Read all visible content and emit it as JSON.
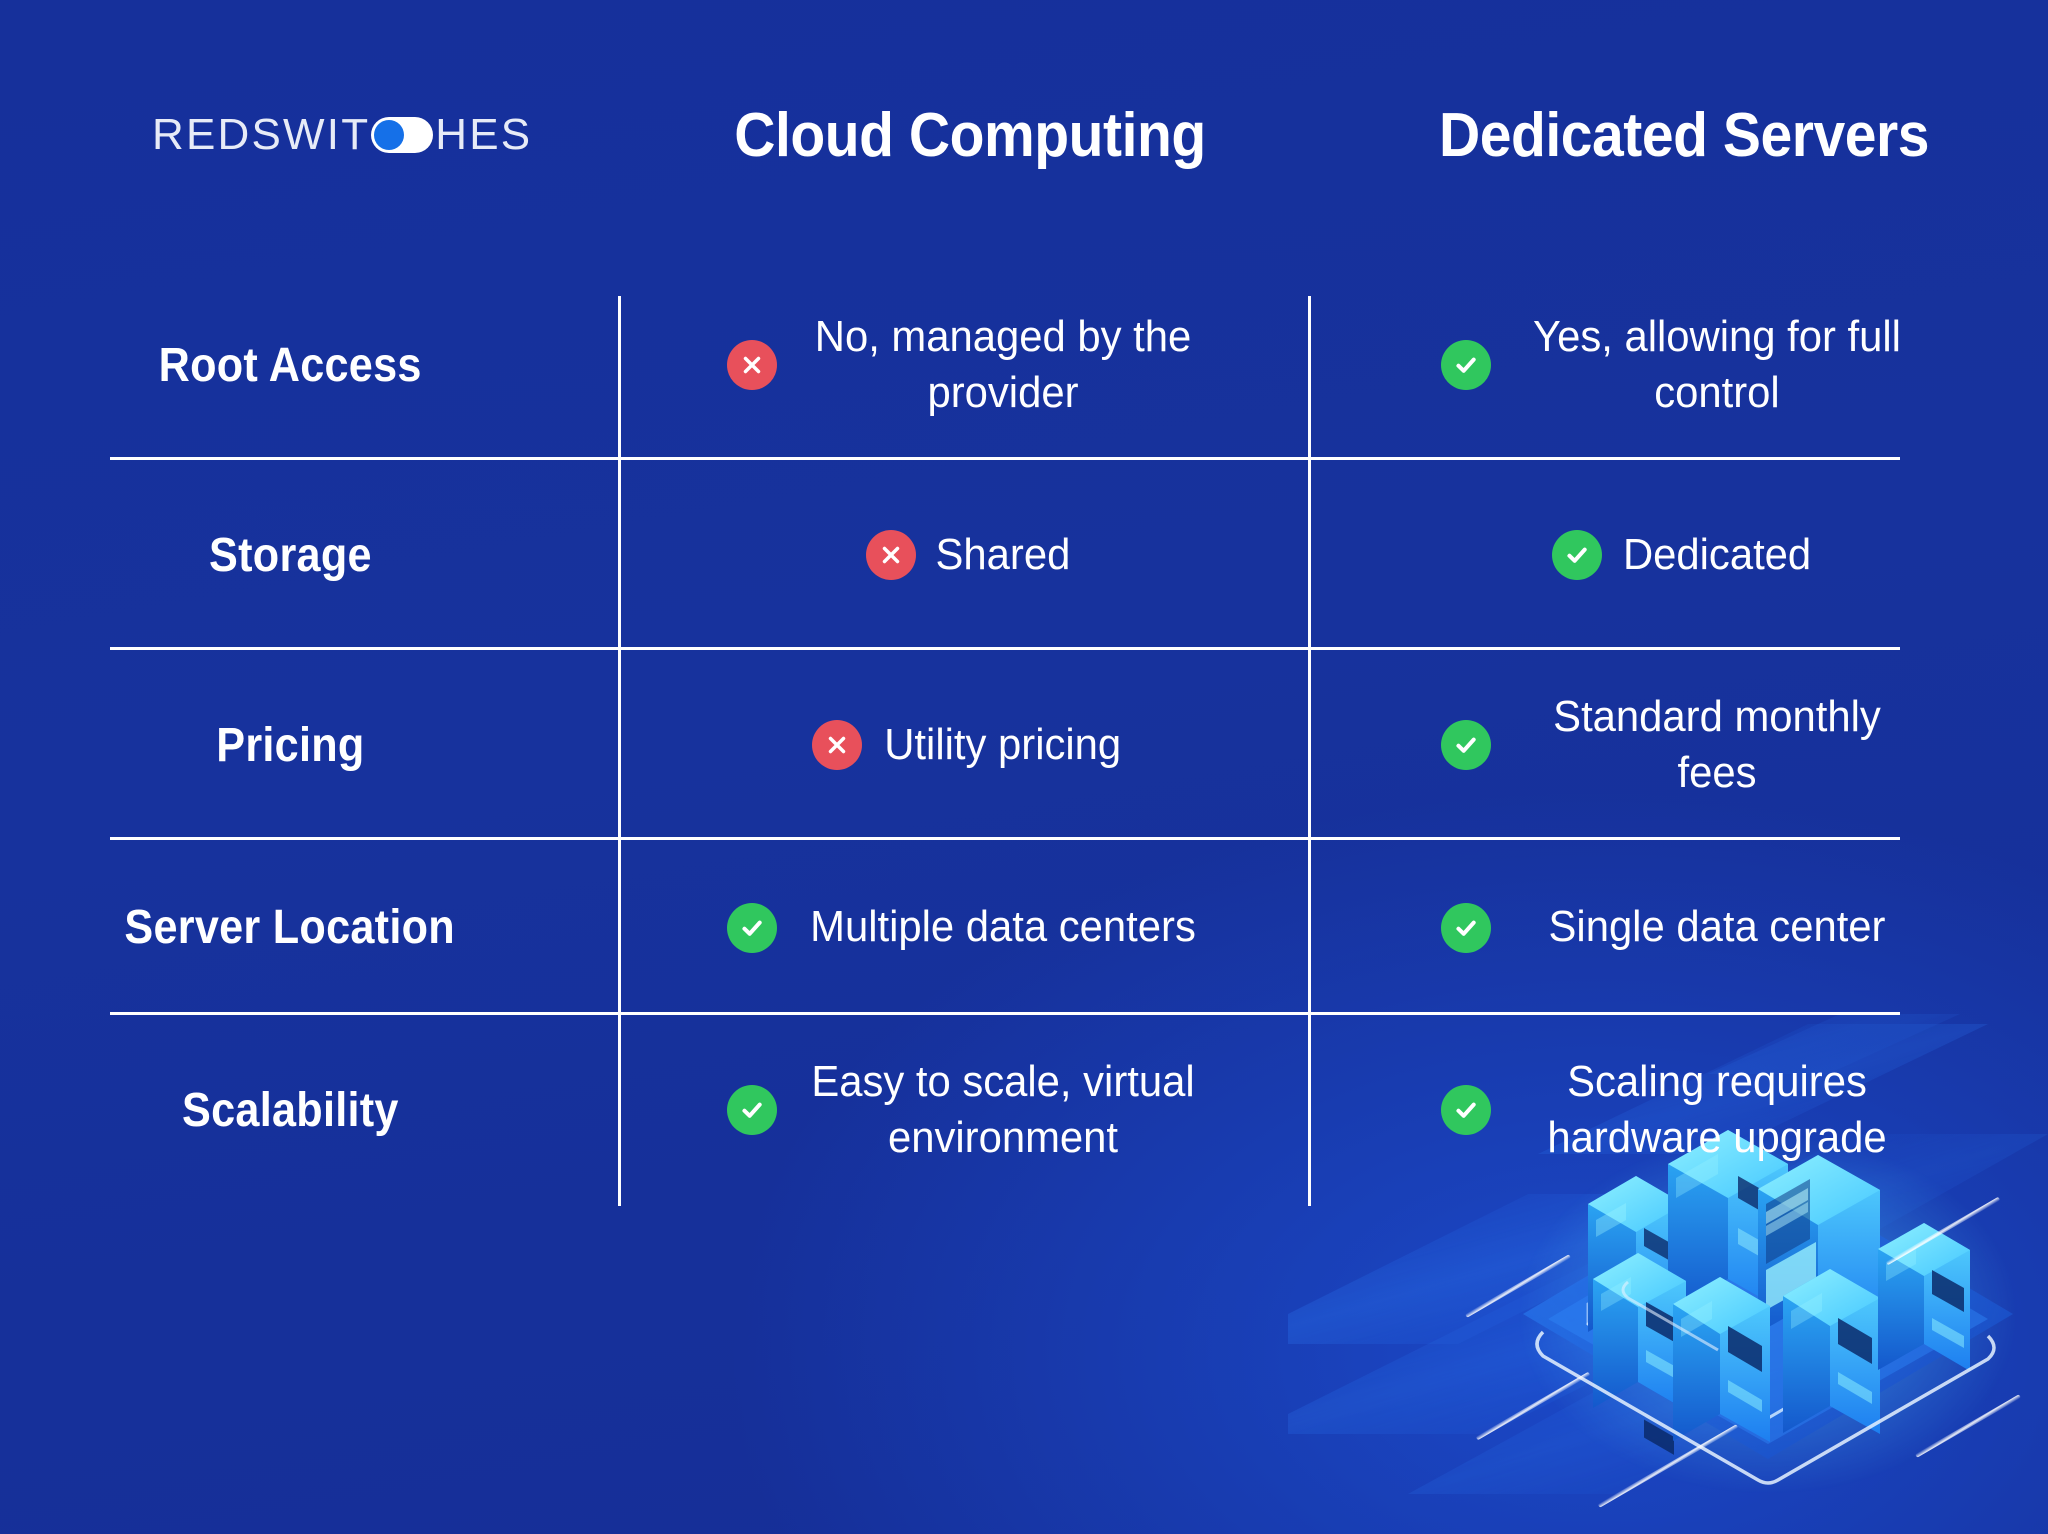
{
  "brand": {
    "logo_text_left": "REDSWIT",
    "logo_toggle_icon": "toggle-switch-icon",
    "logo_text_right": "HES",
    "logo_full": "REDSWITCHES"
  },
  "colors": {
    "background": "#16309b",
    "background_accent": "#1b49c9",
    "divider": "#ffffff",
    "text": "#ffffff",
    "logo_text": "#e7ebf7",
    "icon_no": "#e8505b",
    "icon_yes": "#30c75e",
    "toggle_knob": "#1570e8",
    "illustration_glow": "#33c6ff"
  },
  "table": {
    "headers": {
      "feature_column": "",
      "column_1": "Cloud Computing",
      "column_2": "Dedicated Servers"
    },
    "rows": [
      {
        "label": "Root Access",
        "cloud": {
          "icon": "cross-circle-icon",
          "status": "no",
          "text": "No, managed by the provider",
          "lines": 2
        },
        "dedicated": {
          "icon": "check-circle-icon",
          "status": "yes",
          "text": "Yes, allowing for full control",
          "lines": 2
        }
      },
      {
        "label": "Storage",
        "cloud": {
          "icon": "cross-circle-icon",
          "status": "no",
          "text": "Shared",
          "lines": 1
        },
        "dedicated": {
          "icon": "check-circle-icon",
          "status": "yes",
          "text": "Dedicated",
          "lines": 1
        }
      },
      {
        "label": "Pricing",
        "cloud": {
          "icon": "cross-circle-icon",
          "status": "no",
          "text": "Utility pricing",
          "lines": 1
        },
        "dedicated": {
          "icon": "check-circle-icon",
          "status": "yes",
          "text": "Standard monthly fees",
          "lines": 2
        }
      },
      {
        "label": "Server Location",
        "cloud": {
          "icon": "check-circle-icon",
          "status": "yes",
          "text": "Multiple data centers",
          "lines": 2
        },
        "dedicated": {
          "icon": "check-circle-icon",
          "status": "yes",
          "text": "Single data center",
          "lines": 2
        }
      },
      {
        "label": "Scalability",
        "cloud": {
          "icon": "check-circle-icon",
          "status": "yes",
          "text": "Easy to scale, virtual environment",
          "lines": 2
        },
        "dedicated": {
          "icon": "check-circle-icon",
          "status": "yes",
          "text": "Scaling requires hardware upgrade",
          "lines": 2
        }
      }
    ]
  },
  "illustration": {
    "name": "isometric-server-racks-illustration",
    "description": "Isometric cluster of glowing blue server racks on a platform with diagonal light streaks"
  }
}
